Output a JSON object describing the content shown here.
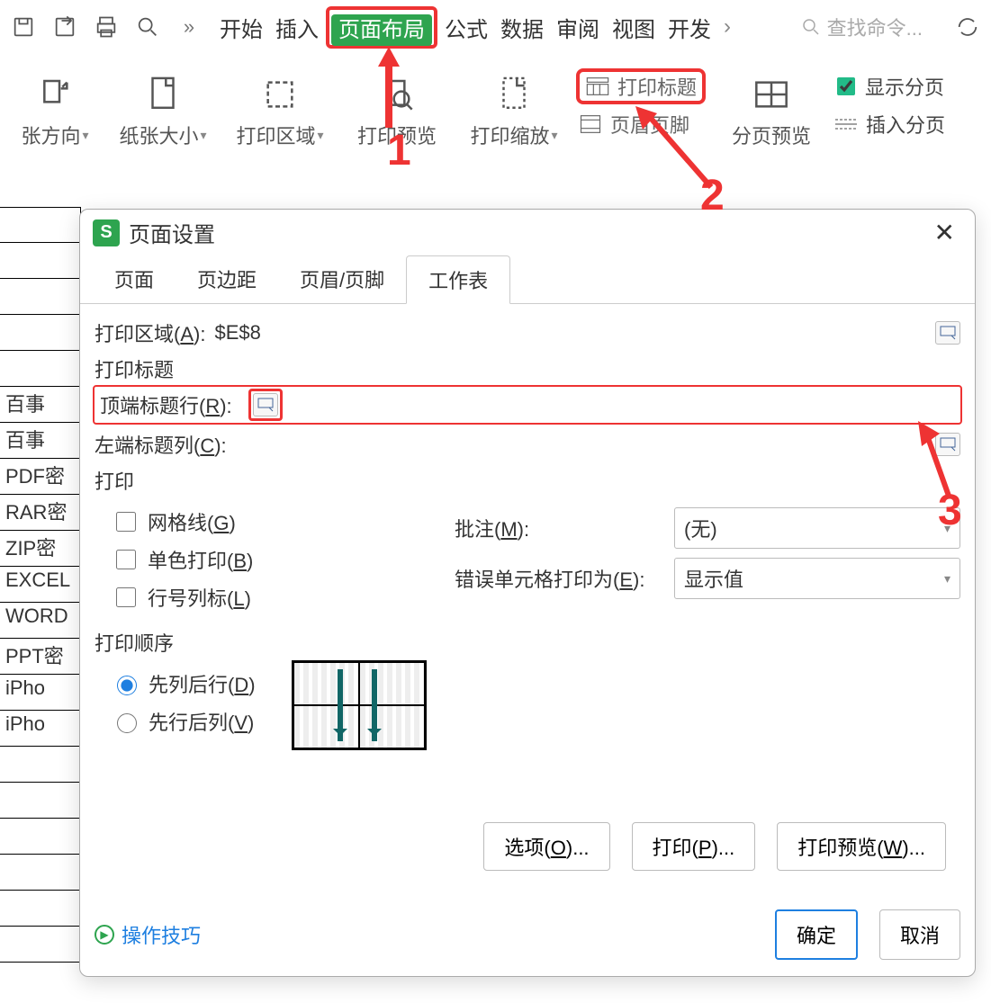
{
  "menu": {
    "start": "开始",
    "insert": "插入",
    "page_layout": "页面布局",
    "formula": "公式",
    "data": "数据",
    "review": "审阅",
    "view": "视图",
    "develop": "开发"
  },
  "search_placeholder": "查找命令...",
  "ribbon": {
    "orientation": "张方向",
    "paper_size": "纸张大小",
    "print_area": "打印区域",
    "print_preview": "打印预览",
    "print_zoom": "打印缩放",
    "print_titles": "打印标题",
    "header_footer": "页眉页脚",
    "page_break_preview": "分页预览",
    "show_page_break": "显示分页",
    "insert_page_break": "插入分页"
  },
  "sheet_rows": [
    "",
    "",
    "",
    "",
    "",
    "",
    "百事",
    "百事",
    "PDF密",
    "RAR密",
    "ZIP密",
    "EXCEL",
    "WORD",
    "PPT密",
    "iPho",
    "iPho",
    "",
    "",
    "",
    "",
    ""
  ],
  "dialog": {
    "title": "页面设置",
    "tabs": {
      "page": "页面",
      "margins": "页边距",
      "hf": "页眉/页脚",
      "sheet": "工作表"
    },
    "print_area_label": "打印区域(",
    "print_area_key": "A",
    "print_area_suffix": "):",
    "print_area_value": "$E$8",
    "print_title_section": "打印标题",
    "top_row_label": "顶端标题行(",
    "top_row_key": "R",
    "top_row_suffix": "):",
    "left_col_label": "左端标题列(",
    "left_col_key": "C",
    "left_col_suffix": "):",
    "print_section": "打印",
    "gridlines": "网格线(",
    "gridlines_key": "G",
    "gridlines_suffix": ")",
    "monochrome": "单色打印(",
    "monochrome_key": "B",
    "monochrome_suffix": ")",
    "rowcol_headings": "行号列标(",
    "rowcol_key": "L",
    "rowcol_suffix": ")",
    "comments_label": "批注(",
    "comments_key": "M",
    "comments_suffix": "):",
    "comments_value": "(无)",
    "errors_label": "错误单元格打印为(",
    "errors_key": "E",
    "errors_suffix": "):",
    "errors_value": "显示值",
    "order_section": "打印顺序",
    "down_over": "先列后行(",
    "down_over_key": "D",
    "down_over_suffix": ")",
    "over_down": "先行后列(",
    "over_down_key": "V",
    "over_down_suffix": ")",
    "options_btn": "选项(",
    "options_key": "O",
    "options_suffix": ")...",
    "print_btn": "打印(",
    "print_key": "P",
    "print_suffix": ")...",
    "preview_btn": "打印预览(",
    "preview_key": "W",
    "preview_suffix": ")...",
    "tips": "操作技巧",
    "ok": "确定",
    "cancel": "取消"
  },
  "annotations": {
    "n1": "1",
    "n2": "2",
    "n3": "3"
  }
}
